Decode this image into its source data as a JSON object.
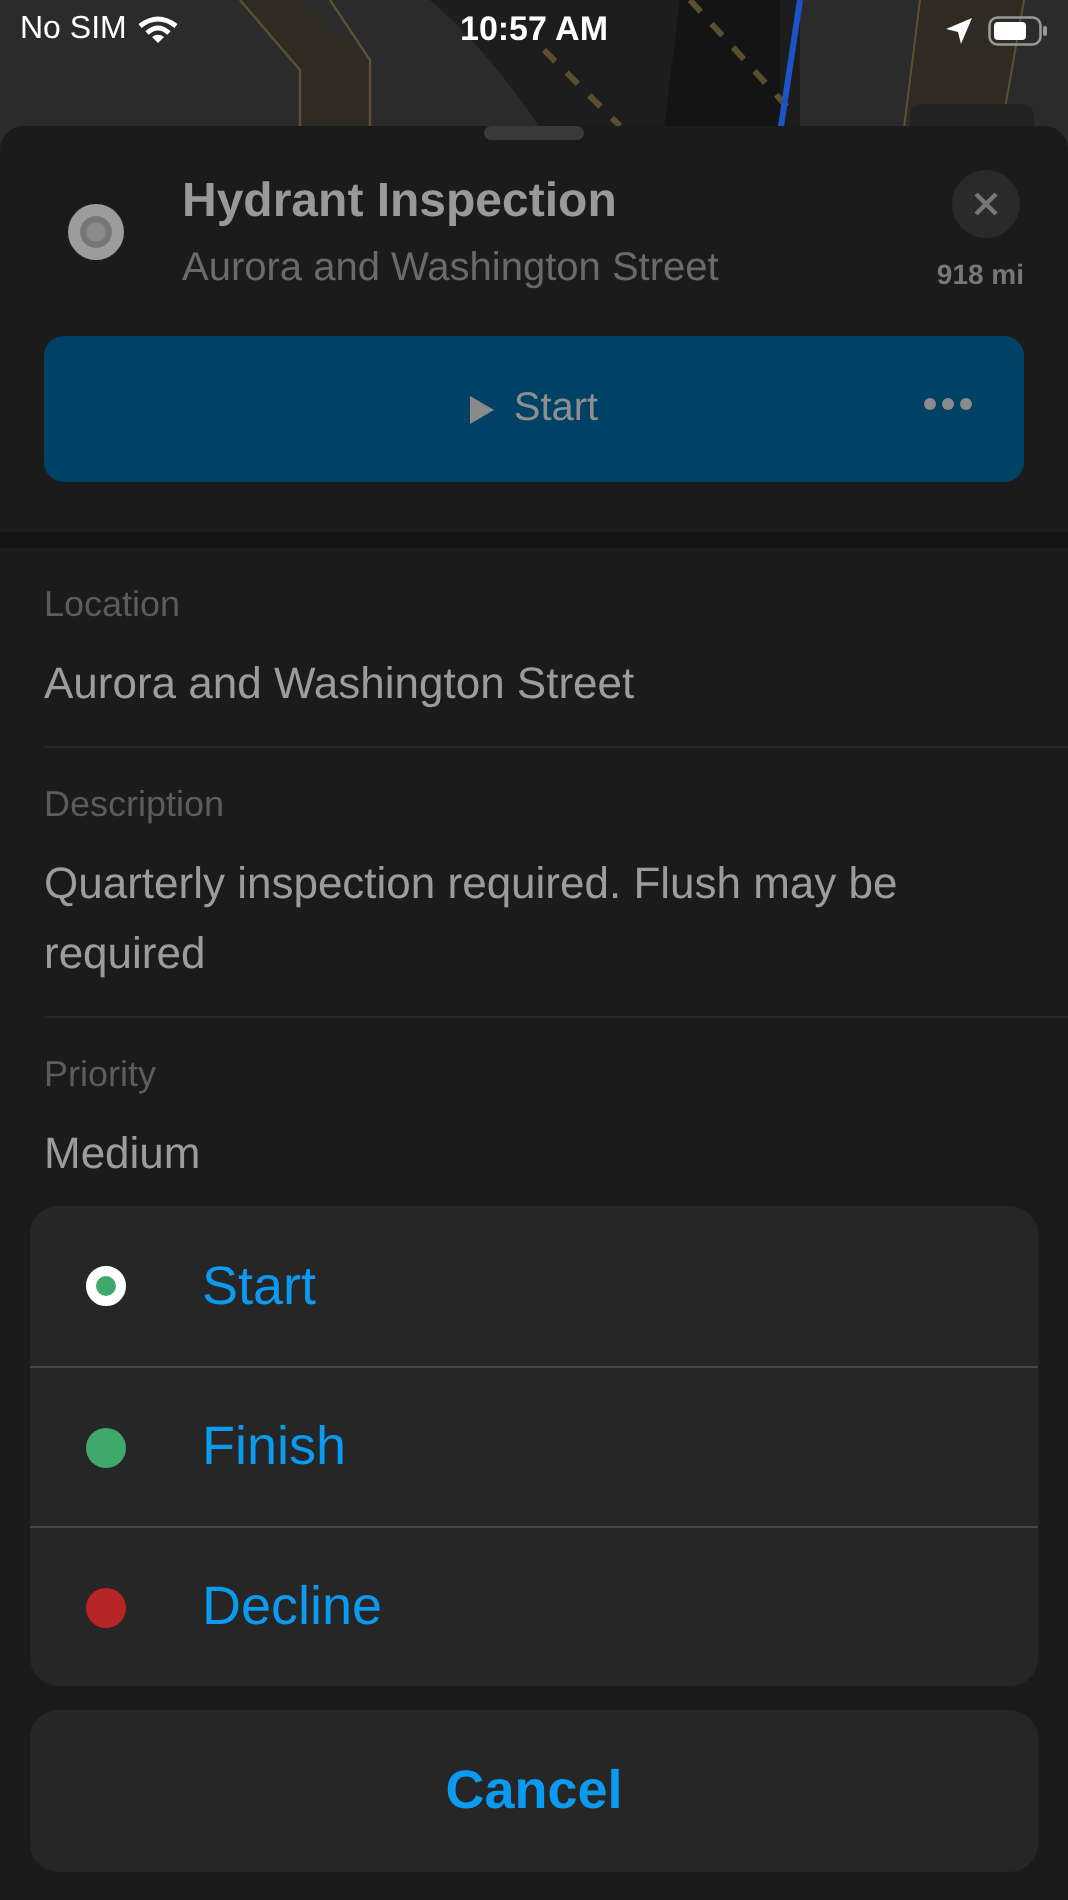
{
  "status_bar": {
    "carrier": "No SIM",
    "time": "10:57 AM"
  },
  "header": {
    "checked": false,
    "title": "Hydrant Inspection",
    "subtitle": "Aurora and Washington Street",
    "distance": "918 mi",
    "primary_button": "Start"
  },
  "fields": [
    {
      "label": "Location",
      "value": "Aurora and Washington Street"
    },
    {
      "label": "Description",
      "value": "Quarterly inspection required. Flush may be required"
    },
    {
      "label": "Priority",
      "value": "Medium"
    }
  ],
  "action_sheet": {
    "actions": [
      {
        "label": "Start",
        "kind": "ring",
        "color": "#3fa86b"
      },
      {
        "label": "Finish",
        "kind": "dot",
        "color": "#3fa86b"
      },
      {
        "label": "Decline",
        "kind": "dot",
        "color": "#b62626"
      }
    ],
    "cancel": "Cancel"
  }
}
